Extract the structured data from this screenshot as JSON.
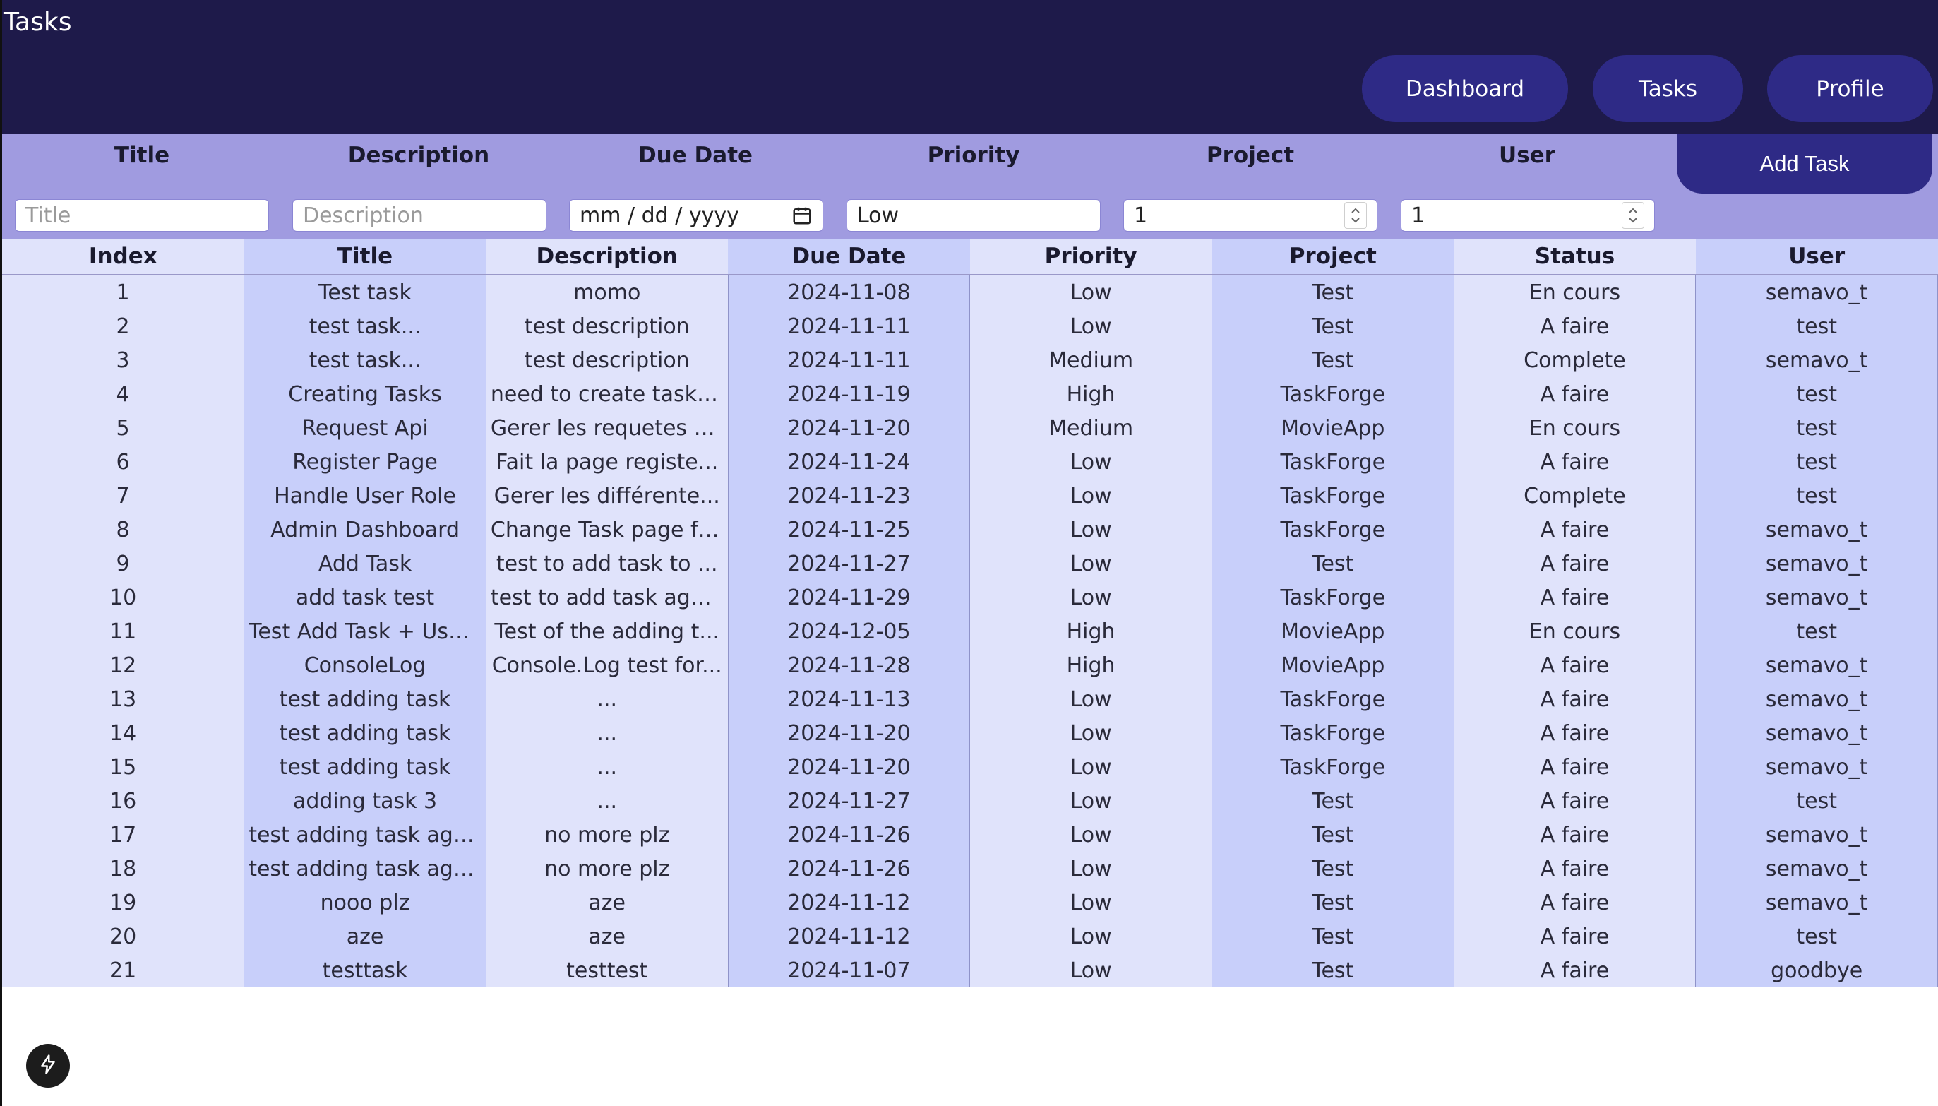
{
  "app": {
    "title": "Tasks"
  },
  "nav": {
    "dashboard": "Dashboard",
    "tasks": "Tasks",
    "profile": "Profile"
  },
  "form": {
    "labels": {
      "title": "Title",
      "description": "Description",
      "due_date": "Due Date",
      "priority": "Priority",
      "project": "Project",
      "user": "User"
    },
    "title_placeholder": "Title",
    "description_placeholder": "Description",
    "due_date_placeholder": "mm / dd / yyyy",
    "priority_value": "Low",
    "project_value": "1",
    "user_value": "1",
    "add_button": "Add Task"
  },
  "table": {
    "headers": [
      "Index",
      "Title",
      "Description",
      "Due Date",
      "Priority",
      "Project",
      "Status",
      "User"
    ],
    "rows": [
      [
        "1",
        "Test task",
        "momo",
        "2024-11-08",
        "Low",
        "Test",
        "En cours",
        "semavo_t"
      ],
      [
        "2",
        "test task...",
        "test description",
        "2024-11-11",
        "Low",
        "Test",
        "A faire",
        "test"
      ],
      [
        "3",
        "test task...",
        "test description",
        "2024-11-11",
        "Medium",
        "Test",
        "Complete",
        "semavo_t"
      ],
      [
        "4",
        "Creating Tasks",
        "need to create tasks...",
        "2024-11-19",
        "High",
        "TaskForge",
        "A faire",
        "test"
      ],
      [
        "5",
        "Request Api",
        "Gerer les requetes s...",
        "2024-11-20",
        "Medium",
        "MovieApp",
        "En cours",
        "test"
      ],
      [
        "6",
        "Register Page",
        "Fait la page registe...",
        "2024-11-24",
        "Low",
        "TaskForge",
        "A faire",
        "test"
      ],
      [
        "7",
        "Handle User Role",
        "Gerer les différente...",
        "2024-11-23",
        "Low",
        "TaskForge",
        "Complete",
        "test"
      ],
      [
        "8",
        "Admin Dashboard",
        "Change Task page for...",
        "2024-11-25",
        "Low",
        "TaskForge",
        "A faire",
        "semavo_t"
      ],
      [
        "9",
        "Add Task",
        "test to add task to ...",
        "2024-11-27",
        "Low",
        "Test",
        "A faire",
        "semavo_t"
      ],
      [
        "10",
        "add task test",
        "test to add task aga...",
        "2024-11-29",
        "Low",
        "TaskForge",
        "A faire",
        "semavo_t"
      ],
      [
        "11",
        "Test Add Task + User...",
        "Test of the adding t...",
        "2024-12-05",
        "High",
        "MovieApp",
        "En cours",
        "test"
      ],
      [
        "12",
        "ConsoleLog",
        "Console.Log test for...",
        "2024-11-28",
        "High",
        "MovieApp",
        "A faire",
        "semavo_t"
      ],
      [
        "13",
        "test adding task",
        "...",
        "2024-11-13",
        "Low",
        "TaskForge",
        "A faire",
        "semavo_t"
      ],
      [
        "14",
        "test adding task",
        "...",
        "2024-11-20",
        "Low",
        "TaskForge",
        "A faire",
        "semavo_t"
      ],
      [
        "15",
        "test adding task",
        "...",
        "2024-11-20",
        "Low",
        "TaskForge",
        "A faire",
        "semavo_t"
      ],
      [
        "16",
        "adding task 3",
        "...",
        "2024-11-27",
        "Low",
        "Test",
        "A faire",
        "test"
      ],
      [
        "17",
        "test adding task aga...",
        "no more plz",
        "2024-11-26",
        "Low",
        "Test",
        "A faire",
        "semavo_t"
      ],
      [
        "18",
        "test adding task aga...",
        "no more plz",
        "2024-11-26",
        "Low",
        "Test",
        "A faire",
        "semavo_t"
      ],
      [
        "19",
        "nooo plz",
        "aze",
        "2024-11-12",
        "Low",
        "Test",
        "A faire",
        "semavo_t"
      ],
      [
        "20",
        "aze",
        "aze",
        "2024-11-12",
        "Low",
        "Test",
        "A faire",
        "test"
      ],
      [
        "21",
        "testtask",
        "testtest",
        "2024-11-07",
        "Low",
        "Test",
        "A faire",
        "goodbye"
      ]
    ]
  },
  "icons": {
    "calendar": "calendar-icon",
    "bolt": "lightning-bolt-icon"
  },
  "colors": {
    "header_bg": "#1e1a4a",
    "button_bg": "#2e2a86",
    "form_band_bg": "#a09be0",
    "col_light": "#e0e3fb",
    "col_dark": "#c8cffa"
  }
}
